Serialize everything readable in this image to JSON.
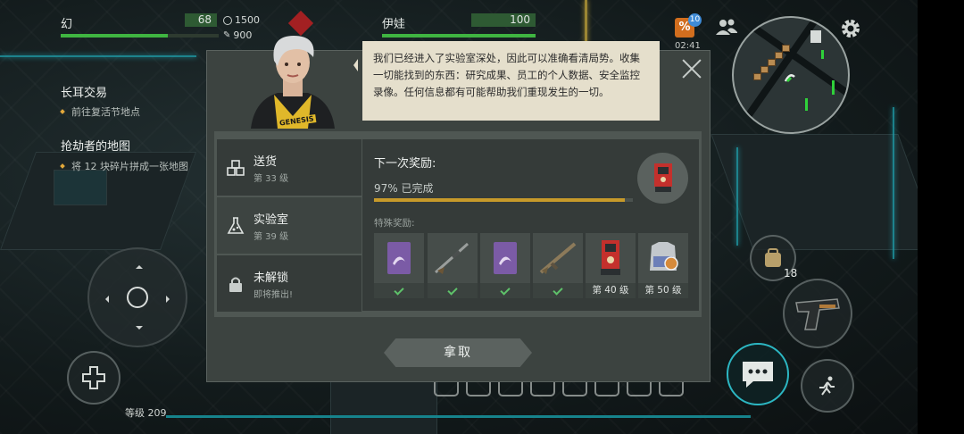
{
  "hud": {
    "player_name": "幻",
    "player_hp": "68",
    "player_hp_fraction": 0.68,
    "resource_1": "1500",
    "resource_2": "900",
    "companion_name": "伊娃",
    "companion_hp": "100",
    "companion_hp_fraction": 1.0,
    "sale_badge": "%",
    "sale_count": "10",
    "timer": "02:41",
    "level_label": "等级 209",
    "ammo_count": "18"
  },
  "quests": [
    {
      "title": "长耳交易",
      "subtitle": "前往复活节地点"
    },
    {
      "title": "抢劫者的地图",
      "subtitle": "将 12 块碎片拼成一张地图"
    }
  ],
  "dialog": {
    "speech": "我们已经进入了实验室深处，因此可以准确看清局势。收集一切能找到的东西：研究成果、员工的个人数据、安全监控录像。任何信息都有可能帮助我们重现发生的一切。",
    "portrait_badge": "GENESIS",
    "tabs": [
      {
        "name": "送货",
        "sub": "第 33 级",
        "icon": "crates-icon"
      },
      {
        "name": "实验室",
        "sub": "第 39 级",
        "icon": "flask-icon"
      },
      {
        "name": "未解锁",
        "sub": "即将推出!",
        "icon": "lock-icon"
      }
    ],
    "next_reward_title": "下一次奖励:",
    "progress_text": "97% 已完成",
    "progress_fraction": 0.97,
    "special_rewards_label": "特殊奖励:",
    "special_rewards": [
      {
        "item": "purple-card",
        "footer": "",
        "claimed": true
      },
      {
        "item": "sniper-rifle",
        "footer": "",
        "claimed": true
      },
      {
        "item": "purple-card",
        "footer": "",
        "claimed": true
      },
      {
        "item": "assault-rifle",
        "footer": "",
        "claimed": true
      },
      {
        "item": "red-machine",
        "footer": "第 40 级",
        "claimed": false
      },
      {
        "item": "armor-vest",
        "footer": "第 50 级",
        "claimed": false
      }
    ],
    "take_button": "拿取"
  },
  "colors": {
    "hp_green": "#3fb541",
    "progress_gold": "#c79a2a",
    "check_green": "#5ec26a",
    "xp_teal": "#16838c"
  }
}
